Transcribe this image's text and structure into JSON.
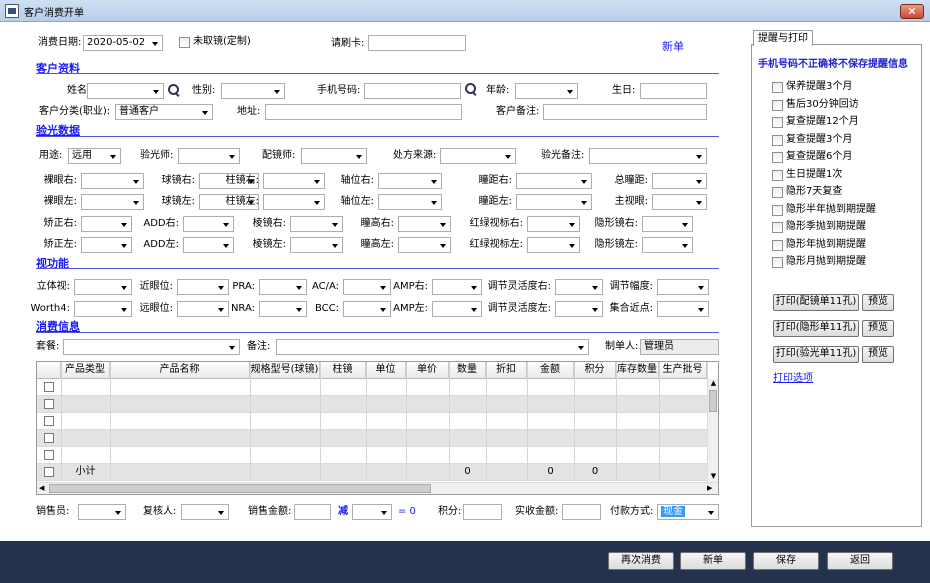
{
  "window": {
    "title": "客户消费开单"
  },
  "top": {
    "date_label": "消费日期:",
    "date_value": "2020-05-02",
    "no_glasses_label": "未取镜(定制)",
    "card_label": "请刷卡:",
    "new_link": "新单"
  },
  "customer": {
    "section": "客户资料",
    "name_label": "姓名:",
    "gender_label": "性别:",
    "phone_label": "手机号码:",
    "age_label": "年龄:",
    "birthday_label": "生日:",
    "category_label": "客户分类(职业):",
    "category_value": "普通客户",
    "address_label": "地址:",
    "note_label": "客户备注:"
  },
  "optometry": {
    "section": "验光数据",
    "use_label": "用途:",
    "use_value": "远用",
    "optometrist_label": "验光师:",
    "fitter_label": "配镜师:",
    "prescription_label": "处方来源:",
    "opt_note_label": "验光备注:",
    "rows": [
      [
        "裸眼右:",
        "球镜右:",
        "柱镜右:",
        "轴位右:",
        "瞳距右:",
        "总瞳距:"
      ],
      [
        "裸眼左:",
        "球镜左:",
        "柱镜左:",
        "轴位左:",
        "瞳距左:",
        "主视眼:"
      ],
      [
        "矫正右:",
        "ADD右:",
        "棱镜右:",
        "瞳高右:",
        "红绿视标右:",
        "隐形镜右:"
      ],
      [
        "矫正左:",
        "ADD左:",
        "棱镜左:",
        "瞳高左:",
        "红绿视标左:",
        "隐形镜左:"
      ]
    ]
  },
  "vision": {
    "section": "视功能",
    "rows": [
      [
        "立体视:",
        "近眼位:",
        "PRA:",
        "AC/A:",
        "AMP右:",
        "调节灵活度右:",
        "调节幅度:"
      ],
      [
        "Worth4:",
        "远眼位:",
        "NRA:",
        "BCC:",
        "AMP左:",
        "调节灵活度左:",
        "集合近点:"
      ]
    ]
  },
  "consumption": {
    "section": "消费信息",
    "package_label": "套餐:",
    "note_label": "备注:",
    "creator_label": "制单人:",
    "creator_value": "管理员"
  },
  "grid": {
    "columns": [
      "产品类型",
      "产品名称",
      "规格型号(球镜)",
      "柱镜",
      "单位",
      "单价",
      "数量",
      "折扣",
      "金额",
      "积分",
      "库存数量",
      "生产批号"
    ],
    "subtotal_label": "小计",
    "subtotal_qty": "0",
    "subtotal_amount": "0",
    "subtotal_points": "0"
  },
  "bottom": {
    "salesperson_label": "销售员:",
    "reviewer_label": "复核人:",
    "sales_amount_label": "销售金额:",
    "minus_label": "减",
    "equals_label": "= 0",
    "points_label": "积分:",
    "received_label": "实收金额:",
    "payment_label": "付款方式:",
    "payment_value": "现金"
  },
  "reminder": {
    "tab": "提醒与打印",
    "warning": "手机号码不正确将不保存提醒信息",
    "items": [
      "保养提醒3个月",
      "售后30分钟回访",
      "复查提醒12个月",
      "复查提醒3个月",
      "复查提醒6个月",
      "生日提醒1次",
      "隐形7天复查",
      "隐形半年抛到期提醒",
      "隐形季抛到期提醒",
      "隐形年抛到期提醒",
      "隐形月抛到期提醒"
    ],
    "print_buttons": [
      "打印(配镜单11孔)",
      "打印(隐形单11孔)",
      "打印(验光单11孔)"
    ],
    "preview_label": "预览",
    "print_options": "打印选项"
  },
  "footer": {
    "buttons": [
      "再次消费",
      "新单",
      "保存",
      "返回"
    ]
  },
  "colors": {
    "accent": "#1a1aff",
    "footer_bg": "#25324d",
    "grid_alt_row": "#e3e3e3"
  }
}
